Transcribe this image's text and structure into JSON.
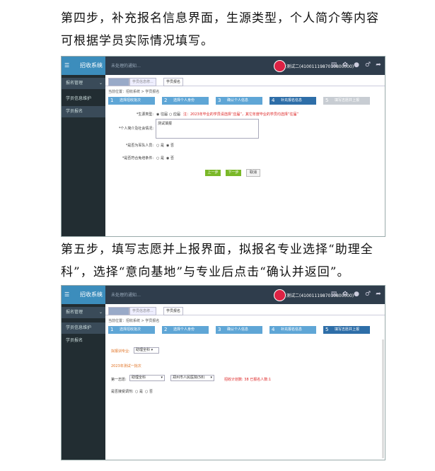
{
  "step4_text": "第四步，补充报名信息界面，生源类型，个人简介等内容可根据学员实际情况填写。",
  "step5_text": "第五步，填写志愿并上报界面，拟报名专业选择“助理全科”，选择“意向基地”与专业后点击“确认并返回”。",
  "ui": {
    "app_name": "招收系统",
    "notice": "未处理的通知…",
    "user": "测试二(4100111987010800000)",
    "tabs": [
      "学员信息修...",
      "学员报名"
    ],
    "breadcrumb": "当前位置：招收系统 > 学员报名",
    "steps": [
      "选择招收批次",
      "选择个人身份",
      "确认个人信息",
      "补充报名信息",
      "填写志愿并上报"
    ],
    "sidebar1": [
      "报名管理",
      "学员信息维护",
      "学员报名"
    ],
    "sidebar2": [
      "报名管理",
      "学员信息维护",
      "学员报名"
    ]
  },
  "form4": {
    "source_label": "*生源类型:",
    "source_opt1": "往届",
    "source_opt2": "应届",
    "source_note": "注：2023年毕业的学员请选择“应届”，其它年度毕业的学员均选择“往届”",
    "intro_label": "*个人简介及社会情况:",
    "intro_value": "测试填报",
    "q1_label": "*是否为军队人员:",
    "q2_label": "*是否符合免培条件:",
    "yes": "是",
    "no": "否",
    "prev": "上一步",
    "next": "下一步",
    "cancel": "取消"
  },
  "form5": {
    "major_label": "拟报训专业:",
    "major_value": "助理全科",
    "batch": "2023年测试一批次",
    "choice_label": "第一志愿:",
    "choice_value": "助理全科",
    "base_value": "郑州市人民医院(58)",
    "plan_text": "招收计划数: 38  已报名人数:1",
    "adjust_label": "是否接受调剂:",
    "yes": "是",
    "no": "否"
  }
}
